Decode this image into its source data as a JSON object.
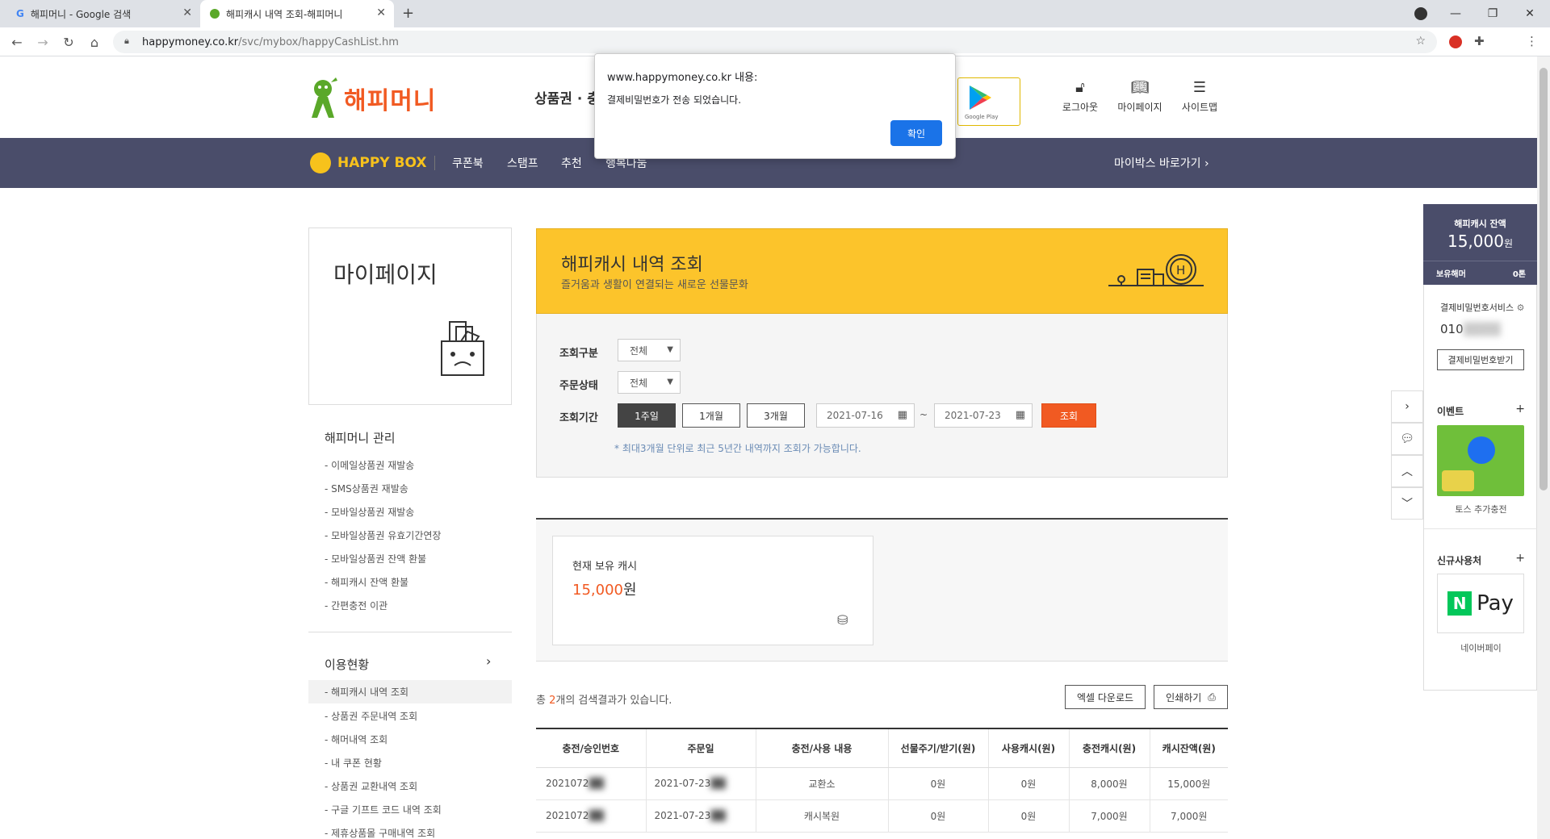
{
  "browser": {
    "tabs": [
      {
        "title": "해피머니 - Google 검색",
        "favicon": "google-icon"
      },
      {
        "title": "해피캐시 내역 조회-해피머니",
        "favicon": "happymoney-icon"
      }
    ],
    "url_domain": "happymoney.co.kr",
    "url_path": "/svc/mybox/happyCashList.hm"
  },
  "header": {
    "logo_text": "해피머니",
    "slogan": "상품권 · 충",
    "links": [
      {
        "label": "로그아웃",
        "icon": "lock-icon"
      },
      {
        "label": "마이페이지",
        "icon": "book-icon"
      },
      {
        "label": "사이트맵",
        "icon": "menu-icon"
      }
    ],
    "google_play": "Google Play"
  },
  "nav": {
    "brand": "HAPPY BOX",
    "items": [
      "쿠폰북",
      "스탬프",
      "추천",
      "행복나눔"
    ],
    "mybox_link": "마이박스 바로가기 ›"
  },
  "sidebar": {
    "title": "마이페이지",
    "section1_title": "해피머니 관리",
    "section1_items": [
      "- 이메일상품권 재발송",
      "- SMS상품권 재발송",
      "- 모바일상품권 재발송",
      "- 모바일상품권 유효기간연장",
      "- 모바일상품권 잔액 환불",
      "- 해피캐시 잔액 환불",
      "- 간편충전 이관"
    ],
    "section2_title": "이용현황",
    "section2_items": [
      "- 해피캐시 내역 조회",
      "- 상품권 주문내역 조회",
      "- 해머내역 조회",
      "- 내 쿠폰 현황",
      "- 상품권 교환내역 조회",
      "- 구글 기프트 코드 내역 조회",
      "- 제휴상품몰 구매내역 조회"
    ]
  },
  "content": {
    "title": "해피캐시 내역 조회",
    "subtitle": "즐거움과 생활이 연결되는 새로운 선물문화",
    "search": {
      "type_label": "조회구분",
      "type_value": "전체",
      "status_label": "주문상태",
      "status_value": "전체",
      "period_label": "조회기간",
      "periods": [
        "1주일",
        "1개월",
        "3개월"
      ],
      "date_from": "2021-07-16",
      "date_sep": "~",
      "date_to": "2021-07-23",
      "query_button": "조회",
      "note": "* 최대3개월 단위로 최근 5년간 내역까지 조회가 가능합니다."
    },
    "balance": {
      "label": "현재 보유 캐시",
      "amount": "15,000",
      "unit": "원"
    },
    "result": {
      "prefix": "총 ",
      "count": "2",
      "suffix": "개의 검색결과가 있습니다."
    },
    "excel_button": "엑셀 다운로드",
    "print_button": "인쇄하기",
    "table": {
      "headers": [
        "충전/승인번호",
        "주문일",
        "충전/사용 내용",
        "선물주기/받기(원)",
        "사용캐시(원)",
        "충전캐시(원)",
        "캐시잔액(원)"
      ],
      "rows": [
        [
          "2021072",
          "2021-07-23",
          "교환소",
          "0원",
          "0원",
          "8,000원",
          "15,000원"
        ],
        [
          "2021072",
          "2021-07-23",
          "캐시복원",
          "0원",
          "0원",
          "7,000원",
          "7,000원"
        ]
      ]
    }
  },
  "right_panel": {
    "balance_label": "해피캐시 잔액",
    "balance_amount": "15,000",
    "balance_unit": "원",
    "hold_label": "보유해머",
    "hold_value": "0톤",
    "pw_service_label": "결제비밀번호서비스",
    "phone_prefix": "010",
    "pw_button": "결제비밀번호받기",
    "event_label": "이벤트",
    "event_caption": "토스 추가충전",
    "new_partner_label": "신규사용처",
    "naverpay_caption": "네이버페이",
    "naverpay_text": "Pay"
  },
  "dialog": {
    "title": "www.happymoney.co.kr 내용:",
    "message": "결제비밀번호가 전송 되었습니다.",
    "ok_button": "확인"
  },
  "colors": {
    "accent": "#f15a22",
    "nav": "#4a4d6a",
    "header_yellow": "#fcc42b",
    "dialog_button": "#1a73e8"
  }
}
